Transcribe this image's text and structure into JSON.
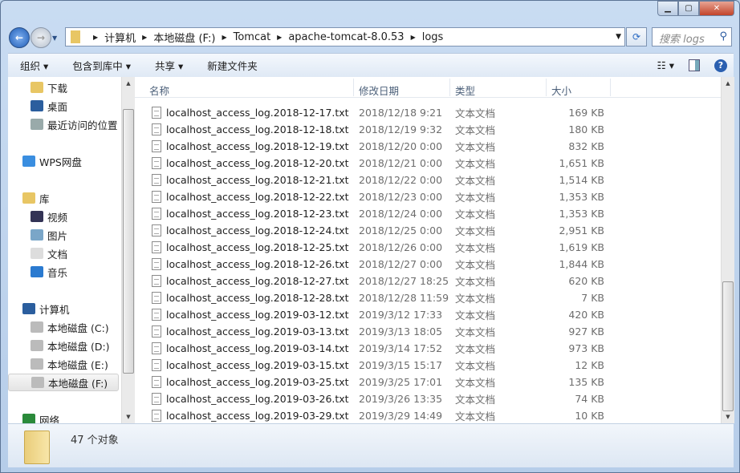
{
  "window": {
    "controls": [
      "minimize",
      "maximize",
      "close"
    ]
  },
  "address": {
    "segments": [
      "计算机",
      "本地磁盘 (F:)",
      "Tomcat",
      "apache-tomcat-8.0.53",
      "logs"
    ]
  },
  "search": {
    "placeholder": "搜索 logs"
  },
  "toolbar": {
    "organize": "组织 ▾",
    "include": "包含到库中 ▾",
    "share": "共享 ▾",
    "new_folder": "新建文件夹"
  },
  "sidebar": {
    "items": [
      {
        "label": "下载",
        "icon": "downloads-icon"
      },
      {
        "label": "桌面",
        "icon": "desktop-icon"
      },
      {
        "label": "最近访问的位置",
        "icon": "recent-places-icon"
      },
      {
        "label": "WPS网盘",
        "icon": "cloud-icon"
      },
      {
        "label": "库",
        "icon": "library-icon"
      },
      {
        "label": "视频",
        "icon": "video-icon"
      },
      {
        "label": "图片",
        "icon": "pictures-icon"
      },
      {
        "label": "文档",
        "icon": "documents-icon"
      },
      {
        "label": "音乐",
        "icon": "music-icon"
      },
      {
        "label": "计算机",
        "icon": "computer-icon"
      },
      {
        "label": "本地磁盘 (C:)",
        "icon": "drive-icon"
      },
      {
        "label": "本地磁盘 (D:)",
        "icon": "drive-icon"
      },
      {
        "label": "本地磁盘 (E:)",
        "icon": "drive-icon"
      },
      {
        "label": "本地磁盘 (F:)",
        "icon": "drive-icon",
        "selected": true
      },
      {
        "label": "网络",
        "icon": "network-icon"
      }
    ]
  },
  "columns": {
    "name": "名称",
    "date": "修改日期",
    "type": "类型",
    "size": "大小"
  },
  "files": [
    {
      "name": "localhost_access_log.2018-12-17.txt",
      "date": "2018/12/18 9:21",
      "type": "文本文档",
      "size": "169 KB"
    },
    {
      "name": "localhost_access_log.2018-12-18.txt",
      "date": "2018/12/19 9:32",
      "type": "文本文档",
      "size": "180 KB"
    },
    {
      "name": "localhost_access_log.2018-12-19.txt",
      "date": "2018/12/20 0:00",
      "type": "文本文档",
      "size": "832 KB"
    },
    {
      "name": "localhost_access_log.2018-12-20.txt",
      "date": "2018/12/21 0:00",
      "type": "文本文档",
      "size": "1,651 KB"
    },
    {
      "name": "localhost_access_log.2018-12-21.txt",
      "date": "2018/12/22 0:00",
      "type": "文本文档",
      "size": "1,514 KB"
    },
    {
      "name": "localhost_access_log.2018-12-22.txt",
      "date": "2018/12/23 0:00",
      "type": "文本文档",
      "size": "1,353 KB"
    },
    {
      "name": "localhost_access_log.2018-12-23.txt",
      "date": "2018/12/24 0:00",
      "type": "文本文档",
      "size": "1,353 KB"
    },
    {
      "name": "localhost_access_log.2018-12-24.txt",
      "date": "2018/12/25 0:00",
      "type": "文本文档",
      "size": "2,951 KB"
    },
    {
      "name": "localhost_access_log.2018-12-25.txt",
      "date": "2018/12/26 0:00",
      "type": "文本文档",
      "size": "1,619 KB"
    },
    {
      "name": "localhost_access_log.2018-12-26.txt",
      "date": "2018/12/27 0:00",
      "type": "文本文档",
      "size": "1,844 KB"
    },
    {
      "name": "localhost_access_log.2018-12-27.txt",
      "date": "2018/12/27 18:25",
      "type": "文本文档",
      "size": "620 KB"
    },
    {
      "name": "localhost_access_log.2018-12-28.txt",
      "date": "2018/12/28 11:59",
      "type": "文本文档",
      "size": "7 KB"
    },
    {
      "name": "localhost_access_log.2019-03-12.txt",
      "date": "2019/3/12 17:33",
      "type": "文本文档",
      "size": "420 KB"
    },
    {
      "name": "localhost_access_log.2019-03-13.txt",
      "date": "2019/3/13 18:05",
      "type": "文本文档",
      "size": "927 KB"
    },
    {
      "name": "localhost_access_log.2019-03-14.txt",
      "date": "2019/3/14 17:52",
      "type": "文本文档",
      "size": "973 KB"
    },
    {
      "name": "localhost_access_log.2019-03-15.txt",
      "date": "2019/3/15 15:17",
      "type": "文本文档",
      "size": "12 KB"
    },
    {
      "name": "localhost_access_log.2019-03-25.txt",
      "date": "2019/3/25 17:01",
      "type": "文本文档",
      "size": "135 KB"
    },
    {
      "name": "localhost_access_log.2019-03-26.txt",
      "date": "2019/3/26 13:35",
      "type": "文本文档",
      "size": "74 KB"
    },
    {
      "name": "localhost_access_log.2019-03-29.txt",
      "date": "2019/3/29 14:49",
      "type": "文本文档",
      "size": "10 KB"
    }
  ],
  "status": {
    "count": "47 个对象"
  }
}
